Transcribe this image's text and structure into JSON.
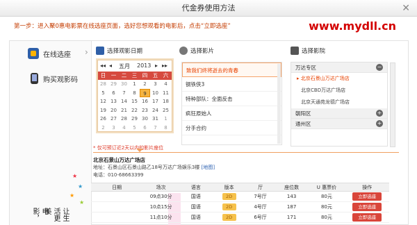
{
  "window": {
    "title": "代金券使用方法",
    "close": "✕"
  },
  "step": "第一步：进入聚0惠电影票在线选座页面，选好您想观看的电影后，点击“立即选座”",
  "brand": "www.mydll.cn",
  "nav": [
    {
      "label": "在线选座",
      "icon": "film-icon"
    },
    {
      "label": "购买观影码",
      "icon": "phone-icon"
    }
  ],
  "slogan": {
    "col1": "电影，",
    "col2": "让生活更美"
  },
  "sections": {
    "date": "选择观影日期",
    "movie": "选择影片",
    "cinema": "选择影院"
  },
  "calendar": {
    "month": "五月",
    "year": "2013",
    "weekdays": [
      "日",
      "一",
      "二",
      "三",
      "四",
      "五",
      "六"
    ],
    "days": [
      "28",
      "29",
      "30",
      "1",
      "2",
      "3",
      "4",
      "5",
      "6",
      "7",
      "8",
      "9",
      "10",
      "11",
      "12",
      "13",
      "14",
      "15",
      "16",
      "17",
      "18",
      "19",
      "20",
      "21",
      "22",
      "23",
      "24",
      "25",
      "26",
      "27",
      "28",
      "29",
      "30",
      "31",
      "1",
      "2",
      "3",
      "4",
      "5",
      "6",
      "7",
      "8"
    ],
    "selected_index": 11,
    "current_month_start": 3,
    "current_month_end": 33
  },
  "movies": [
    "致我们终将逝去的青春",
    "钢铁侠3",
    "特种部队：全面反击",
    "疯狂原始人",
    "分手合约"
  ],
  "movie_selected_index": 0,
  "areas": [
    {
      "name": "万达专区",
      "expanded": true,
      "icon": "minus-icon",
      "cinemas": [
        "北京石景山万达广场店",
        "北京CBD万达广场店",
        "北京天通苑龙德广场店"
      ]
    },
    {
      "name": "朝阳区",
      "expanded": false,
      "icon": "plus-icon"
    },
    {
      "name": "通州区",
      "expanded": false,
      "icon": "plus-icon"
    }
  ],
  "note": "* 仅可预订近2天以内的影片座位",
  "cinema_info": {
    "name": "北京石景山万达广场店",
    "address_prefix": "地址：石景山区石景山路乙18号万达广场娱乐3楼",
    "map_link": "[地图]",
    "phone": "电话：010-68663399"
  },
  "schedule": {
    "headers": [
      "日期",
      "场次",
      "语言",
      "版本",
      "厅",
      "座位数",
      "U 惠票价",
      "操作"
    ],
    "rows": [
      {
        "date": "",
        "time": "09点30分",
        "lang": "国语",
        "ver": "2D",
        "hall": "7号厅",
        "seats": "143",
        "price": "80元",
        "action": "立即选座"
      },
      {
        "date": "",
        "time": "10点15分",
        "lang": "国语",
        "ver": "2D",
        "hall": "4号厅",
        "seats": "187",
        "price": "80元",
        "action": "立即选座"
      },
      {
        "date": "",
        "time": "11点10分",
        "lang": "国语",
        "ver": "2D",
        "hall": "6号厅",
        "seats": "171",
        "price": "80元",
        "action": "立即选座"
      }
    ]
  },
  "colors": {
    "accent": "#d9453a",
    "brand_red": "#d30000",
    "selected_orange": "#e84200"
  }
}
